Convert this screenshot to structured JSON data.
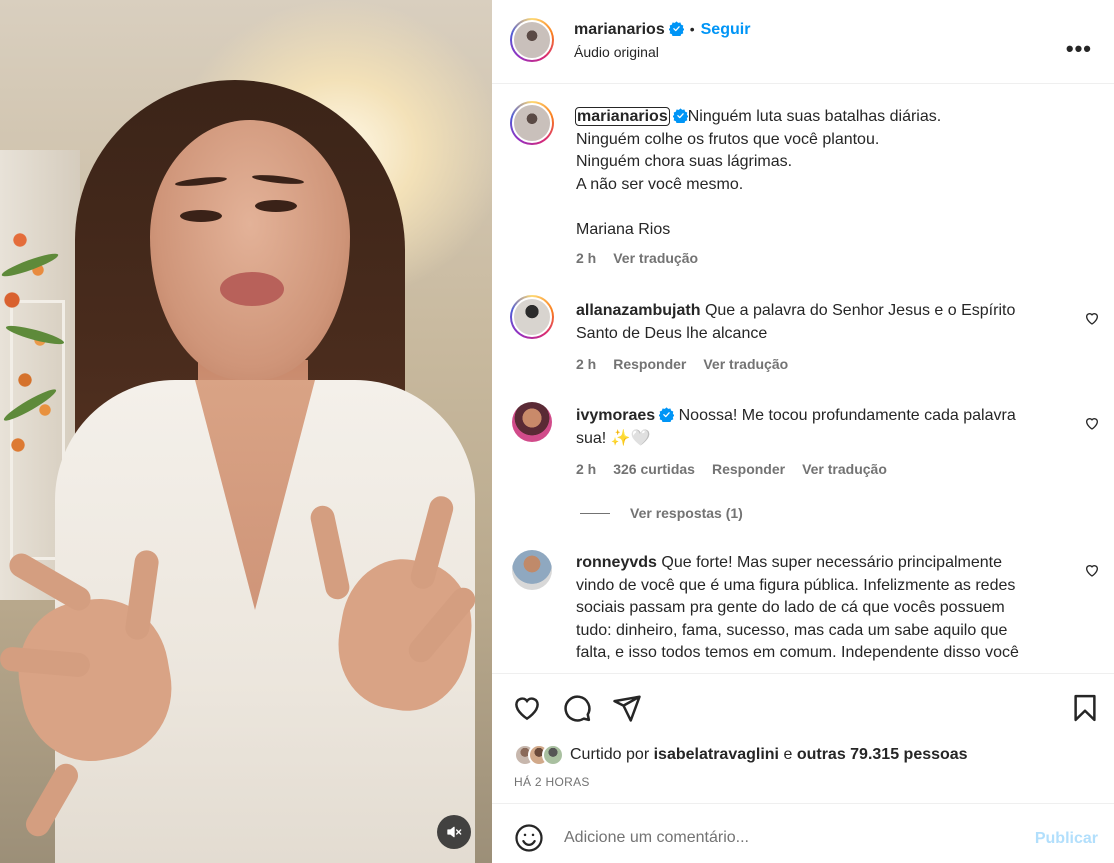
{
  "post": {
    "author": "marianarios",
    "follow_label": "Seguir",
    "separator": "•",
    "audio": "Áudio original",
    "more_label": "•••"
  },
  "caption": {
    "author": "marianarios",
    "lines": [
      "Ninguém luta suas batalhas diárias.",
      "Ninguém colhe os frutos que você plantou.",
      "Ninguém chora suas lágrimas.",
      "A não ser você mesmo.",
      "",
      "Mariana Rios"
    ],
    "time": "2 h",
    "translate_label": "Ver tradução"
  },
  "comments": [
    {
      "user": "allanazambujath",
      "text_line1": "Que a palavra do Senhor Jesus e o Espírito",
      "text_line2": "Santo de Deus lhe alcance",
      "time": "2 h",
      "reply_label": "Responder",
      "translate_label": "Ver tradução"
    },
    {
      "user": "ivymoraes",
      "verified": true,
      "text_line1": "Noossa! Me tocou profundamente cada palavra",
      "text_line2": "sua! ✨🤍",
      "time": "2 h",
      "likes": "326 curtidas",
      "reply_label": "Responder",
      "translate_label": "Ver tradução",
      "view_replies": "Ver respostas (1)"
    },
    {
      "user": "ronneyvds",
      "text_lines": [
        "Que forte! Mas super necessário principalmente",
        "vindo de você que é uma figura pública. Infelizmente as redes",
        "sociais passam pra gente do lado de cá que vocês possuem",
        "tudo: dinheiro, fama, sucesso, mas cada um sabe aquilo que",
        "falta, e isso todos temos em comum. Independente disso você"
      ]
    }
  ],
  "actions": {
    "icons": [
      "heart-icon",
      "comment-icon",
      "share-icon",
      "bookmark-icon"
    ],
    "liked_by_prefix": "Curtido por",
    "liked_by_user": "isabelatravaglini",
    "liked_by_and": "e",
    "liked_by_others": "outras 79.315 pessoas",
    "time_ago": "HÁ 2 HORAS"
  },
  "comment_box": {
    "placeholder": "Adicione um comentário...",
    "publish_label": "Publicar"
  },
  "colors": {
    "accent": "#0095f6",
    "text": "#262626",
    "muted": "#737373",
    "publish_disabled": "#b2dffc",
    "border": "#efefef"
  }
}
